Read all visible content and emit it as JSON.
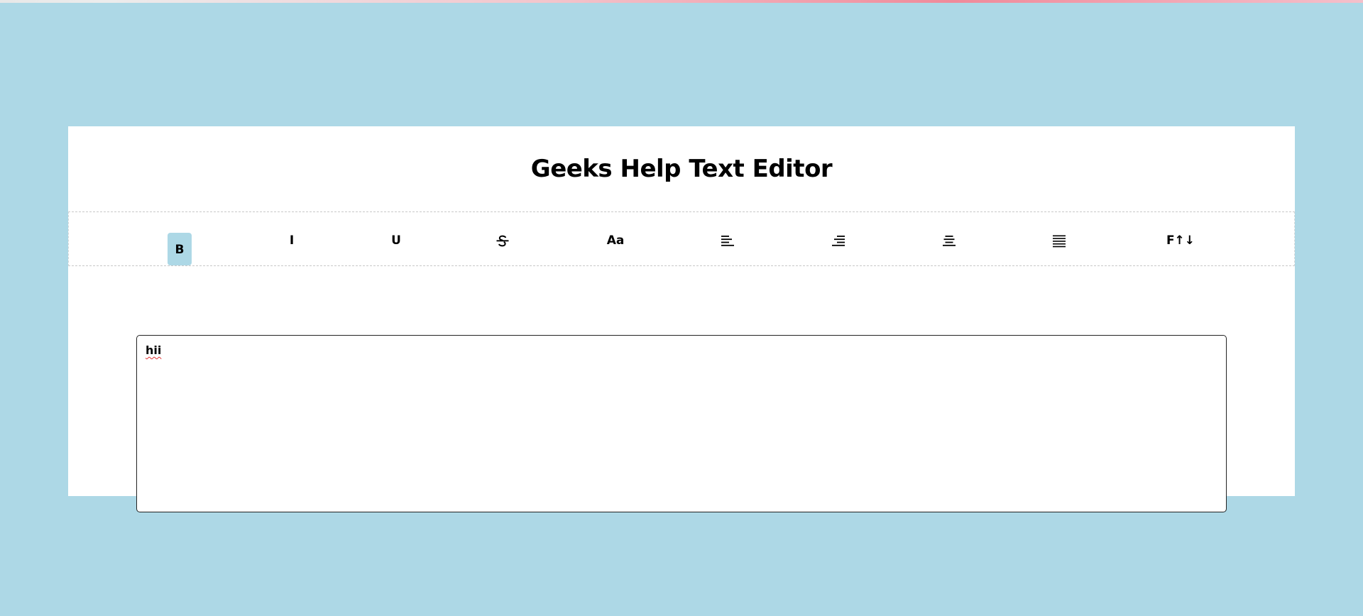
{
  "app": {
    "title": "Geeks Help Text Editor"
  },
  "toolbar": {
    "bold": "B",
    "italic": "I",
    "underline": "U",
    "font_case": "Aa",
    "font_size": "F↑↓",
    "icons": {
      "strikethrough": "strikethrough-icon",
      "align_left": "align-left-icon",
      "align_right": "align-right-icon",
      "align_center": "align-center-icon",
      "align_justify": "align-justify-icon"
    },
    "active": "bold"
  },
  "editor": {
    "value": "hii"
  },
  "colors": {
    "page_background": "#add8e6",
    "active_button": "#add8e6",
    "spellcheck_underline": "#e03030"
  }
}
